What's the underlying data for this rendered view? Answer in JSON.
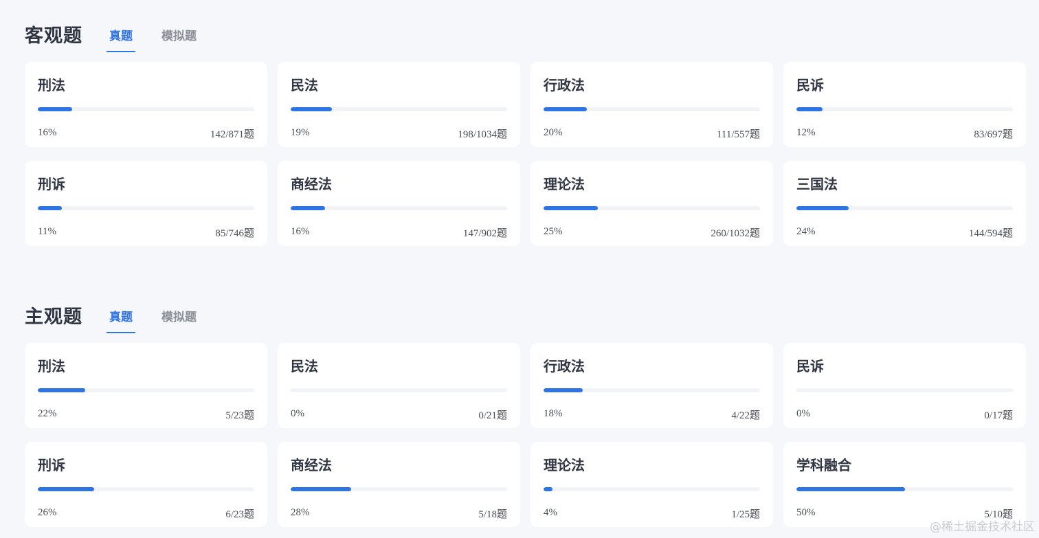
{
  "objective": {
    "title": "客观题",
    "tabs": [
      {
        "label": "真题",
        "active": true
      },
      {
        "label": "模拟题",
        "active": false
      }
    ],
    "cards": [
      {
        "name": "刑法",
        "percent_label": "16%",
        "progress": 0.16,
        "count_label": "142/871题"
      },
      {
        "name": "民法",
        "percent_label": "19%",
        "progress": 0.19,
        "count_label": "198/1034题"
      },
      {
        "name": "行政法",
        "percent_label": "20%",
        "progress": 0.2,
        "count_label": "111/557题"
      },
      {
        "name": "民诉",
        "percent_label": "12%",
        "progress": 0.12,
        "count_label": "83/697题"
      },
      {
        "name": "刑诉",
        "percent_label": "11%",
        "progress": 0.11,
        "count_label": "85/746题"
      },
      {
        "name": "商经法",
        "percent_label": "16%",
        "progress": 0.16,
        "count_label": "147/902题"
      },
      {
        "name": "理论法",
        "percent_label": "25%",
        "progress": 0.25,
        "count_label": "260/1032题"
      },
      {
        "name": "三国法",
        "percent_label": "24%",
        "progress": 0.24,
        "count_label": "144/594题"
      }
    ]
  },
  "subjective": {
    "title": "主观题",
    "tabs": [
      {
        "label": "真题",
        "active": true
      },
      {
        "label": "模拟题",
        "active": false
      }
    ],
    "cards": [
      {
        "name": "刑法",
        "percent_label": "22%",
        "progress": 0.22,
        "count_label": "5/23题"
      },
      {
        "name": "民法",
        "percent_label": "0%",
        "progress": 0.0,
        "count_label": "0/21题"
      },
      {
        "name": "行政法",
        "percent_label": "18%",
        "progress": 0.18,
        "count_label": "4/22题"
      },
      {
        "name": "民诉",
        "percent_label": "0%",
        "progress": 0.0,
        "count_label": "0/17题"
      },
      {
        "name": "刑诉",
        "percent_label": "26%",
        "progress": 0.26,
        "count_label": "6/23题"
      },
      {
        "name": "商经法",
        "percent_label": "28%",
        "progress": 0.28,
        "count_label": "5/18题"
      },
      {
        "name": "理论法",
        "percent_label": "4%",
        "progress": 0.04,
        "count_label": "1/25题"
      },
      {
        "name": "学科融合",
        "percent_label": "50%",
        "progress": 0.5,
        "count_label": "5/10题"
      }
    ]
  },
  "colors": {
    "accent": "#2f74e6",
    "background": "#f5f7fa",
    "card": "#ffffff",
    "track": "#f1f3f6"
  },
  "watermark": "@稀土掘金技术社区"
}
